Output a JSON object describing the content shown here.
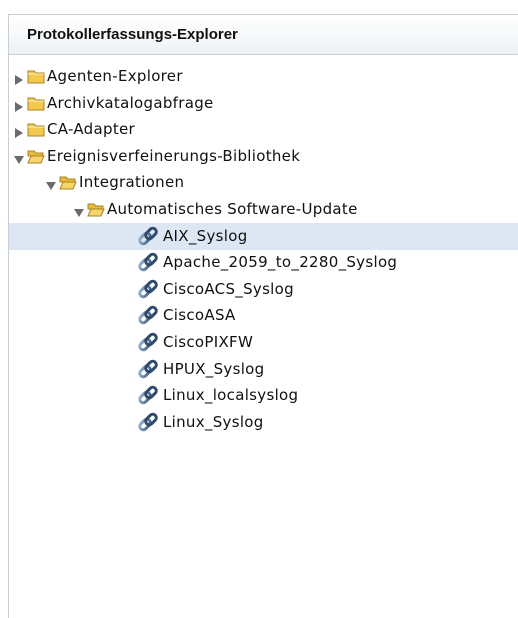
{
  "panel": {
    "title": "Protokollerfassungs-Explorer"
  },
  "tree": [
    {
      "label": "Agenten-Explorer",
      "icon": "folder-closed-icon",
      "expander": "collapsed",
      "level": 0
    },
    {
      "label": "Archivkatalogabfrage",
      "icon": "folder-closed-icon",
      "expander": "collapsed",
      "level": 0
    },
    {
      "label": "CA-Adapter",
      "icon": "folder-closed-icon",
      "expander": "collapsed",
      "level": 0
    },
    {
      "label": "Ereignisverfeinerungs-Bibliothek",
      "icon": "folder-open-icon",
      "expander": "expanded",
      "level": 0
    },
    {
      "label": "Integrationen",
      "icon": "folder-open-icon",
      "expander": "expanded",
      "level": 1
    },
    {
      "label": "Automatisches Software-Update",
      "icon": "folder-open-icon",
      "expander": "expanded",
      "level": 2
    },
    {
      "label": "AIX_Syslog",
      "icon": "integration-link-icon",
      "level": 3,
      "selected": true
    },
    {
      "label": "Apache_2059_to_2280_Syslog",
      "icon": "integration-link-icon",
      "level": 3
    },
    {
      "label": "CiscoACS_Syslog",
      "icon": "integration-link-icon",
      "level": 3
    },
    {
      "label": "CiscoASA",
      "icon": "integration-link-icon",
      "level": 3
    },
    {
      "label": "CiscoPIXFW",
      "icon": "integration-link-icon",
      "level": 3
    },
    {
      "label": "HPUX_Syslog",
      "icon": "integration-link-icon",
      "level": 3
    },
    {
      "label": "Linux_localsyslog",
      "icon": "integration-link-icon",
      "level": 3
    },
    {
      "label": "Linux_Syslog",
      "icon": "integration-link-icon",
      "level": 3
    }
  ],
  "colors": {
    "selection": "#dde6f3",
    "folder": "#f2c94c",
    "link_icon": "#4a6b91"
  }
}
